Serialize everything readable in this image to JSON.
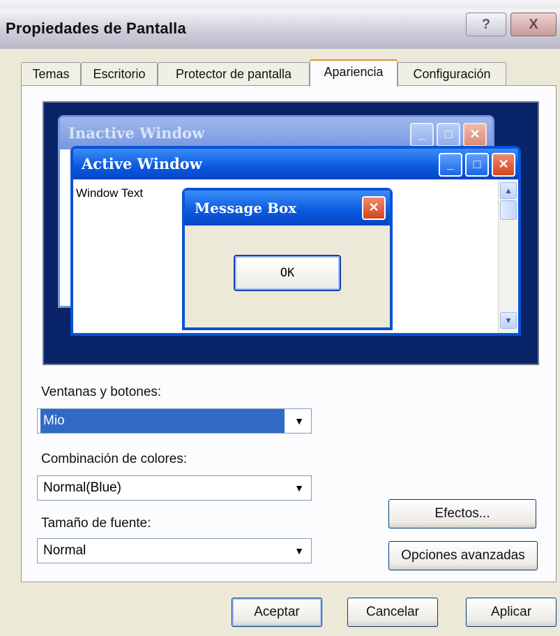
{
  "window": {
    "title": "Propiedades de Pantalla",
    "help_glyph": "?",
    "close_glyph": "X"
  },
  "tabs": [
    {
      "label": "Temas",
      "active": false
    },
    {
      "label": "Escritorio",
      "active": false
    },
    {
      "label": "Protector de pantalla",
      "active": false
    },
    {
      "label": "Apariencia",
      "active": true
    },
    {
      "label": "Configuración",
      "active": false
    }
  ],
  "preview": {
    "inactive_window_title": "Inactive Window",
    "active_window_title": "Active Window",
    "window_text": "Window Text",
    "message_box_title": "Message Box",
    "ok_label": "OK",
    "colors": {
      "desktop": "#0a246a",
      "active_titlebar": "#0a58de",
      "inactive_titlebar": "#7a96df"
    }
  },
  "form": {
    "windows_buttons_label": "Ventanas y botones:",
    "windows_buttons_value": "Mio",
    "color_scheme_label": "Combinación de colores:",
    "color_scheme_value": "Normal(Blue)",
    "font_size_label": "Tamaño de fuente:",
    "font_size_value": "Normal",
    "effects_label": "Efectos...",
    "advanced_label": "Opciones avanzadas"
  },
  "footer": {
    "ok_label": "Aceptar",
    "cancel_label": "Cancelar",
    "apply_label": "Aplicar"
  }
}
